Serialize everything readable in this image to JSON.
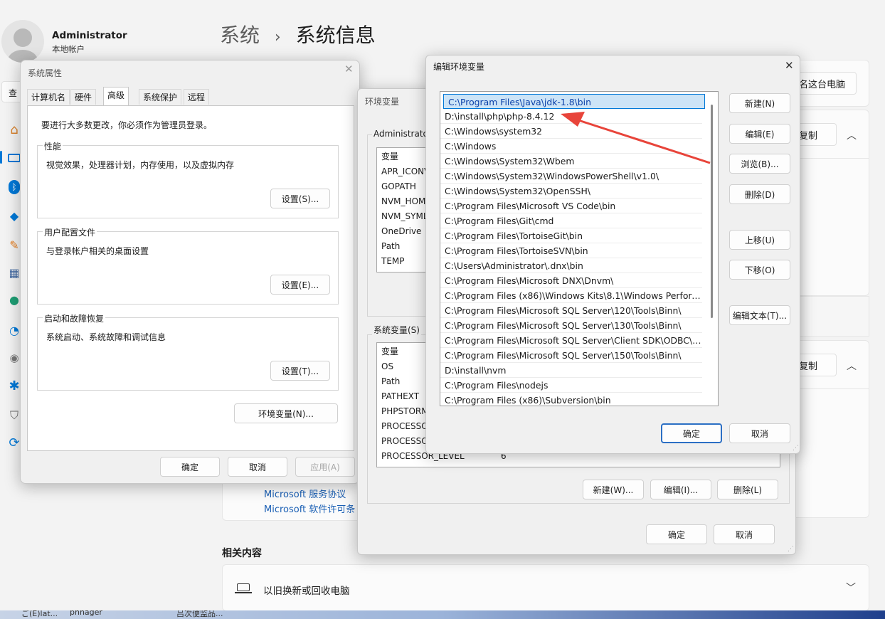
{
  "account": {
    "name": "Administrator",
    "type": "本地帐户"
  },
  "breadcrumb": {
    "parent": "系统",
    "sep": "›",
    "current": "系统信息"
  },
  "settings": {
    "search_stub": "查",
    "rename_button": "名这台电脑",
    "copy1": "复制",
    "copy2": "复制",
    "link_services": "Microsoft 服务协议",
    "link_license": "Microsoft 软件许可条",
    "related_title": "相关内容",
    "related_item": "以旧换新或回收电脑"
  },
  "taskbar": {
    "items": [
      "ご(E)lat...",
      "phhager",
      "吕次便监品..."
    ]
  },
  "sysprops": {
    "title": "系统属性",
    "tabs": [
      "计算机名",
      "硬件",
      "高级",
      "系统保护",
      "远程"
    ],
    "notice": "要进行大多数更改，你必须作为管理员登录。",
    "perf_label": "性能",
    "perf_desc": "视觉效果，处理器计划，内存使用，以及虚拟内存",
    "perf_btn": "设置(S)...",
    "profile_label": "用户配置文件",
    "profile_desc": "与登录帐户相关的桌面设置",
    "profile_btn": "设置(E)...",
    "startup_label": "启动和故障恢复",
    "startup_desc": "系统启动、系统故障和调试信息",
    "startup_btn": "设置(T)...",
    "env_btn": "环境变量(N)...",
    "ok": "确定",
    "cancel": "取消",
    "apply": "应用(A)"
  },
  "envvars": {
    "title": "环境变量",
    "user_label": "Administrato",
    "user_header": "变量",
    "user_vars": [
      "APR_ICONV",
      "GOPATH",
      "NVM_HOM",
      "NVM_SYML",
      "OneDrive",
      "Path",
      "TEMP"
    ],
    "sys_label": "系统变量(S)",
    "sys_header": "变量",
    "sys_vars": [
      "OS",
      "Path",
      "PATHEXT",
      "PHPSTORM",
      "PROCESSO",
      "PROCESSO",
      "PROCESSOR_LEVEL"
    ],
    "sys_last_value": "6",
    "new_btn": "新建(W)...",
    "edit_btn": "编辑(I)...",
    "delete_btn": "删除(L)",
    "ok": "确定",
    "cancel": "取消"
  },
  "editenv": {
    "title": "编辑环境变量",
    "paths": [
      "C:\\Program Files\\Java\\jdk-1.8\\bin",
      "D:\\install\\php\\php-8.4.12",
      "C:\\Windows\\system32",
      "C:\\Windows",
      "C:\\Windows\\System32\\Wbem",
      "C:\\Windows\\System32\\WindowsPowerShell\\v1.0\\",
      "C:\\Windows\\System32\\OpenSSH\\",
      "C:\\Program Files\\Microsoft VS Code\\bin",
      "C:\\Program Files\\Git\\cmd",
      "C:\\Program Files\\TortoiseGit\\bin",
      "C:\\Program Files\\TortoiseSVN\\bin",
      "C:\\Users\\Administrator\\.dnx\\bin",
      "C:\\Program Files\\Microsoft DNX\\Dnvm\\",
      "C:\\Program Files (x86)\\Windows Kits\\8.1\\Windows Performa...",
      "C:\\Program Files\\Microsoft SQL Server\\120\\Tools\\Binn\\",
      "C:\\Program Files\\Microsoft SQL Server\\130\\Tools\\Binn\\",
      "C:\\Program Files\\Microsoft SQL Server\\Client SDK\\ODBC\\17...",
      "C:\\Program Files\\Microsoft SQL Server\\150\\Tools\\Binn\\",
      "D:\\install\\nvm",
      "C:\\Program Files\\nodejs",
      "C:\\Program Files (x86)\\Subversion\\bin"
    ],
    "new_btn": "新建(N)",
    "edit_btn": "编辑(E)",
    "browse_btn": "浏览(B)...",
    "delete_btn": "删除(D)",
    "up_btn": "上移(U)",
    "down_btn": "下移(O)",
    "edit_text_btn": "编辑文本(T)...",
    "ok": "确定",
    "cancel": "取消"
  },
  "colors": {
    "accent": "#0078d7",
    "link": "#1a5fb4",
    "arrow": "#e8443a",
    "selection": "#cce4f7"
  }
}
